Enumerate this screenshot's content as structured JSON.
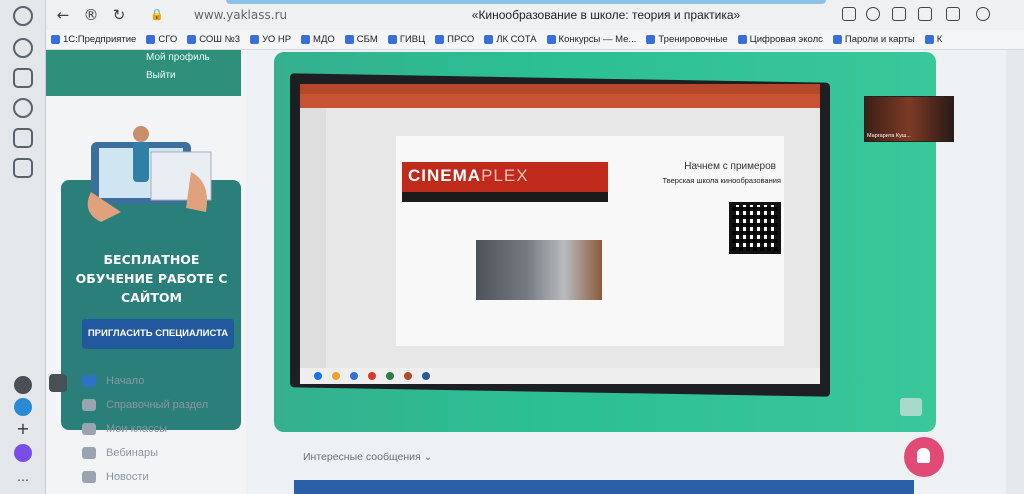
{
  "browser": {
    "address": "www.yaklass.ru",
    "page_title": "«Кинообразование в школе: теория и практика»",
    "bookmarks": [
      "1С:Предприятие",
      "СГО",
      "СОШ №3",
      "УО НР",
      "МДО",
      "СБМ",
      "ГИВЦ",
      "ПРСО",
      "ЛК СОТА",
      "Конкурсы — Ме...",
      "Тренировочные",
      "Цифровая эколс",
      "Пароли и карты",
      "К"
    ]
  },
  "sidebar": {
    "profile_link": "Мой профиль",
    "logout_link": "Выйти",
    "promo_text": "БЕСПЛАТНОЕ ОБУЧЕНИЕ РАБОТЕ С САЙТОМ",
    "promo_button": "ПРИГЛАСИТЬ СПЕЦИАЛИСТА",
    "nav": [
      "Начало",
      "Справочный раздел",
      "Мои классы",
      "Вебинары",
      "Новости"
    ]
  },
  "video": {
    "slide_heading": "Начнем с примеров",
    "slide_sub": "Тверская школа кинообразования",
    "logo_left": "CINEMA",
    "logo_right": "PLEX",
    "cam_name": "Маргарита Куш..."
  },
  "main": {
    "interesting_messages": "Интересные сообщения"
  }
}
